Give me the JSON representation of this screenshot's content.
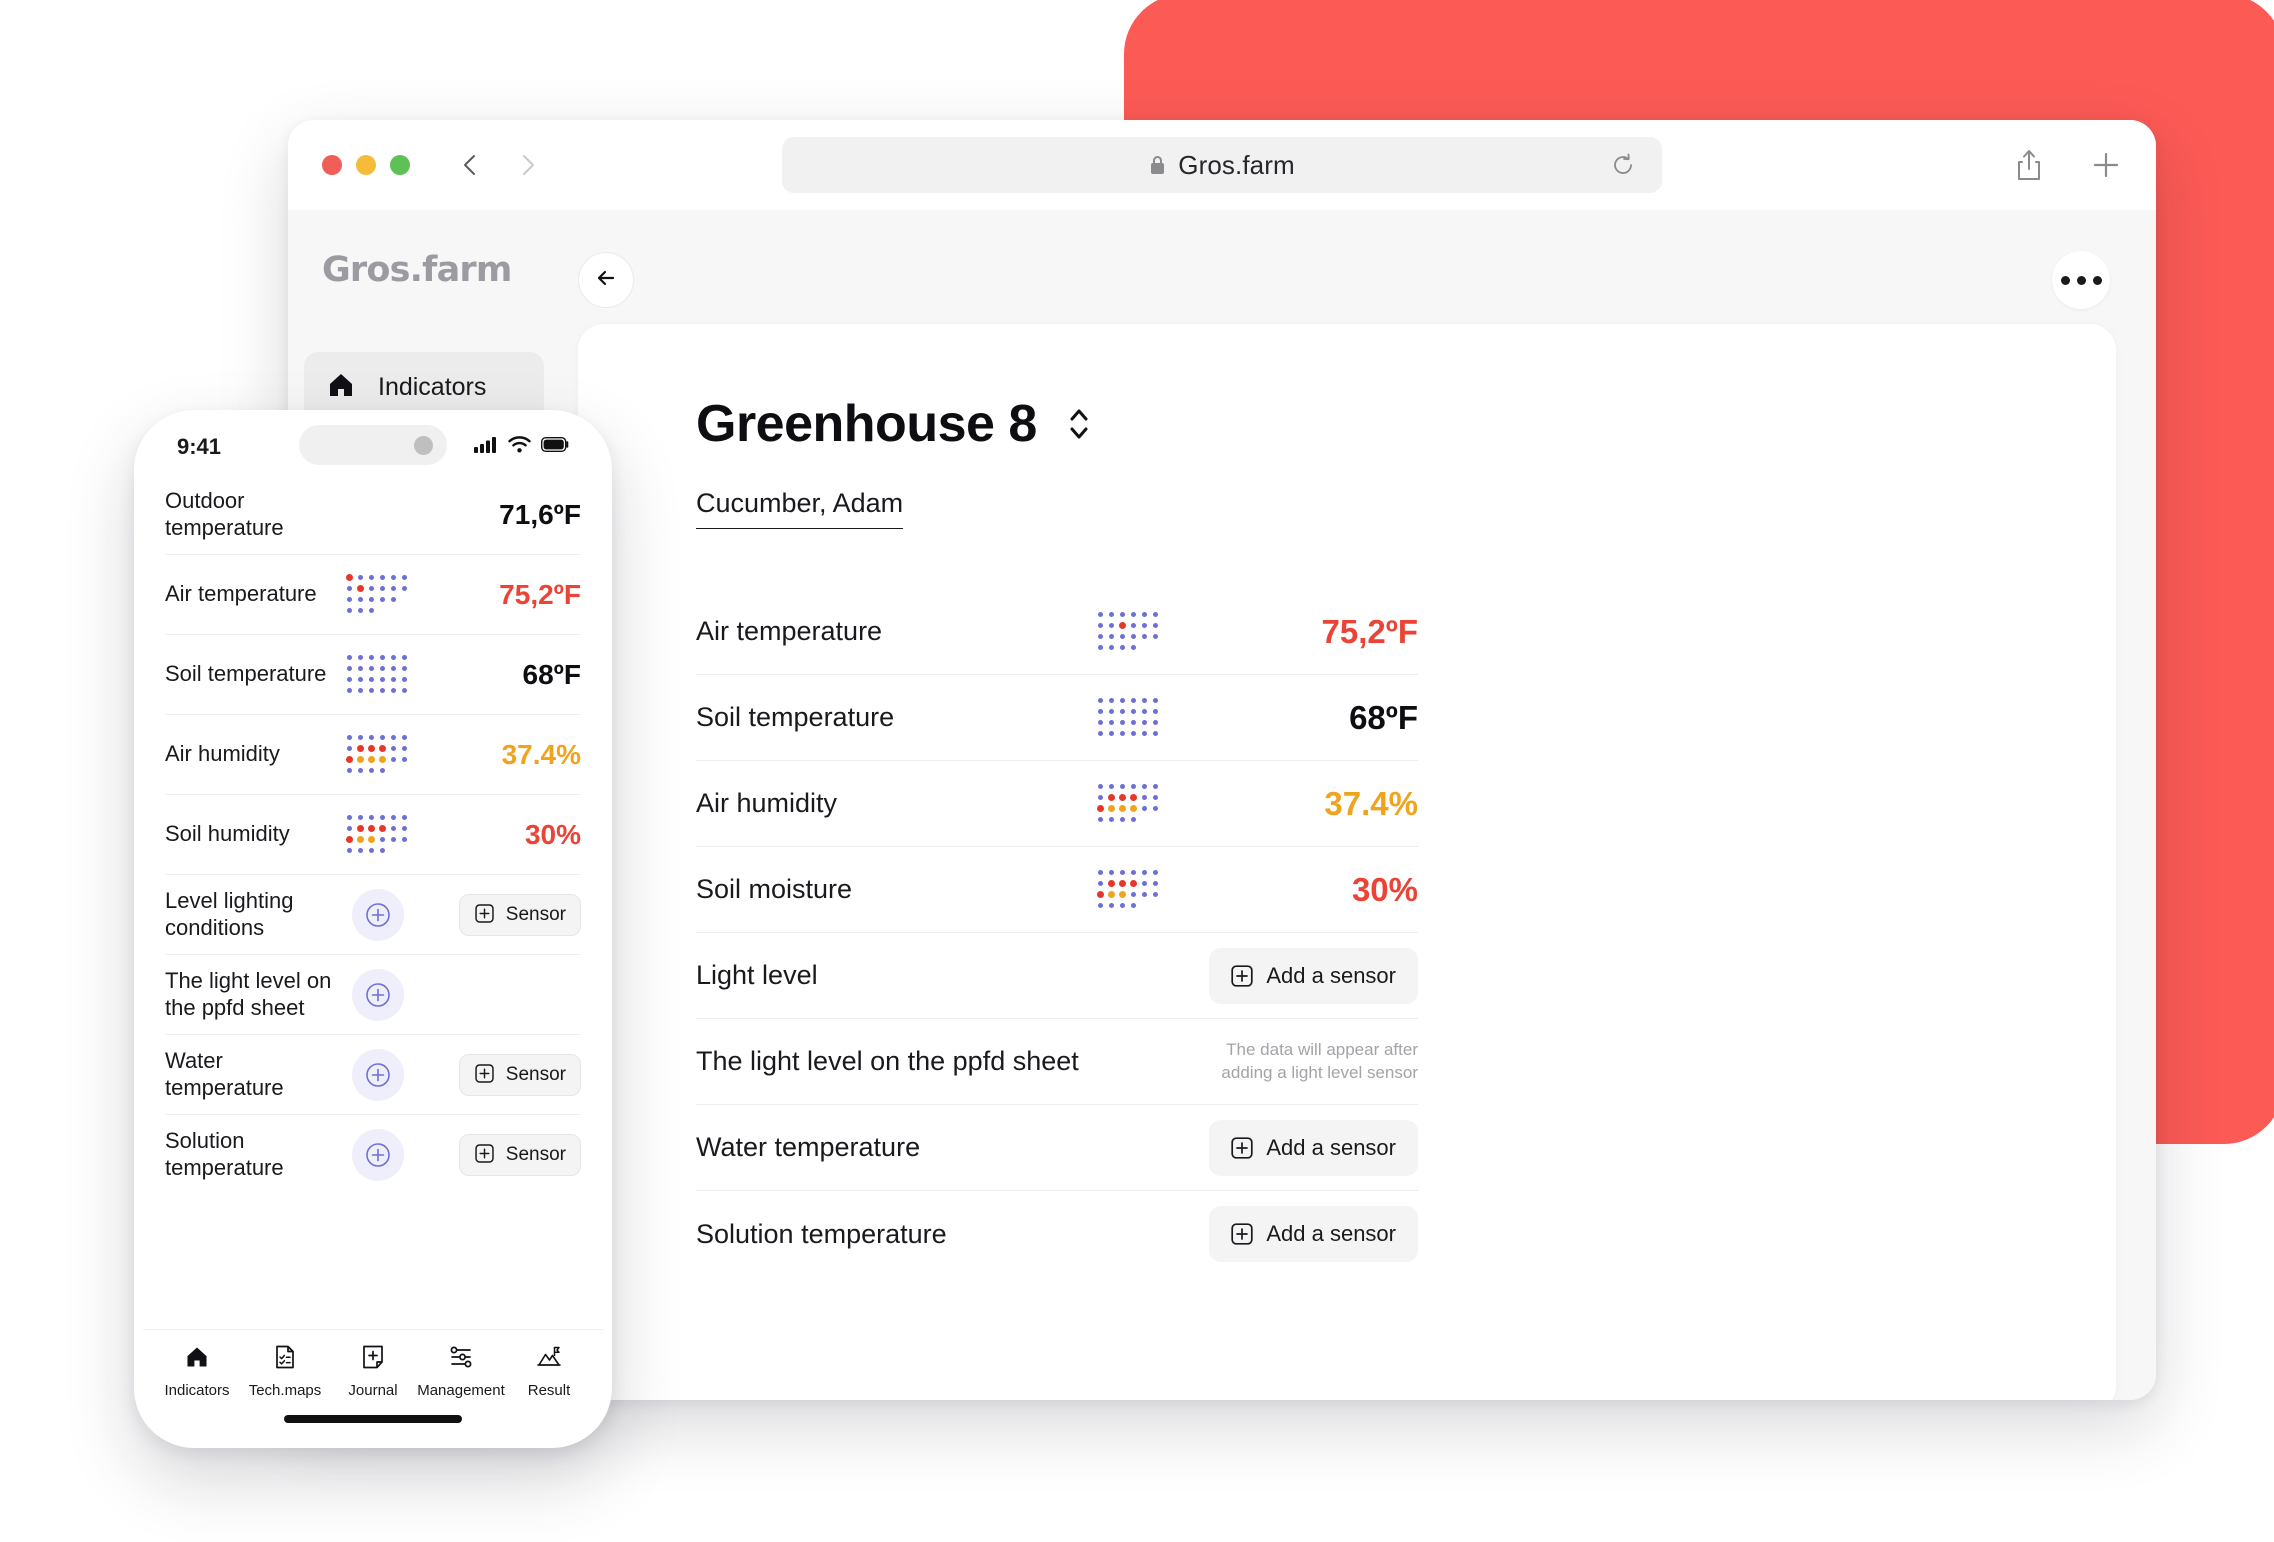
{
  "browser": {
    "url_text": "Gros.farm",
    "lock_icon": "lock-icon",
    "reload_icon": "reload-icon",
    "back_icon": "chevron-left-icon",
    "forward_icon": "chevron-right-icon",
    "share_icon": "share-icon",
    "newtab_icon": "plus-icon",
    "traffic_lights": [
      "close-red",
      "minimize-yellow",
      "zoom-green"
    ]
  },
  "app": {
    "brand": "Gros.farm",
    "back_button_icon": "arrow-left-icon",
    "more_button_icon": "ellipsis-icon",
    "sidebar": {
      "items": [
        {
          "label": "Indicators",
          "icon": "home-icon",
          "active": true
        }
      ]
    },
    "header": {
      "title": "Greenhouse 8",
      "selector_icon": "chevron-up-down-icon",
      "crop": "Cucumber, Adam"
    },
    "rows": [
      {
        "label": "Air temperature",
        "value": "75,2ºF",
        "color": "red",
        "indicator": "dot-matrix",
        "level": "high"
      },
      {
        "label": "Soil temperature",
        "value": "68ºF",
        "color": "dark",
        "indicator": "dot-matrix",
        "level": "normal"
      },
      {
        "label": "Air humidity",
        "value": "37.4%",
        "color": "orange",
        "indicator": "dot-matrix",
        "level": "low"
      },
      {
        "label": "Soil moisture",
        "value": "30%",
        "color": "red",
        "indicator": "dot-matrix",
        "level": "low"
      },
      {
        "label": "Light level",
        "action": "Add a sensor"
      },
      {
        "label": "The light level on the ppfd sheet",
        "hint": "The data will appear after adding a light level sensor"
      },
      {
        "label": "Water temperature",
        "action": "Add a sensor"
      },
      {
        "label": "Solution temperature",
        "action": "Add a sensor"
      }
    ],
    "add_sensor_label": "Add a sensor"
  },
  "phone": {
    "status": {
      "time": "9:41",
      "signal_icon": "cellular-icon",
      "wifi_icon": "wifi-icon",
      "battery_icon": "battery-icon"
    },
    "rows": [
      {
        "label": "Outdoor temperature",
        "value": "71,6ºF",
        "color": "dark",
        "indicator": "none"
      },
      {
        "label": "Air temperature",
        "value": "75,2ºF",
        "color": "red",
        "indicator": "dot-matrix",
        "level": "high"
      },
      {
        "label": "Soil temperature",
        "value": "68ºF",
        "color": "dark",
        "indicator": "dot-matrix",
        "level": "normal"
      },
      {
        "label": "Air humidity",
        "value": "37.4%",
        "color": "orange",
        "indicator": "dot-matrix",
        "level": "low"
      },
      {
        "label": "Soil humidity",
        "value": "30%",
        "color": "red",
        "indicator": "dot-matrix",
        "level": "low"
      },
      {
        "label": "Level lighting conditions",
        "add_circle": true,
        "action": "Sensor"
      },
      {
        "label": "The light level on the ppfd sheet",
        "add_circle": true
      },
      {
        "label": "Water temperature",
        "add_circle": true,
        "action": "Sensor"
      },
      {
        "label": "Solution temperature",
        "add_circle": true,
        "action": "Sensor"
      }
    ],
    "tabs": [
      {
        "label": "Indicators",
        "icon": "home-icon",
        "active": true
      },
      {
        "label": "Tech.maps",
        "icon": "document-check-icon",
        "active": false
      },
      {
        "label": "Journal",
        "icon": "document-plus-icon",
        "active": false
      },
      {
        "label": "Management",
        "icon": "sliders-icon",
        "active": false
      },
      {
        "label": "Result",
        "icon": "mountain-flag-icon",
        "active": false
      }
    ]
  },
  "colors": {
    "accent_red": "#FC5A55",
    "value_red": "#EB4335",
    "value_orange": "#F0A41E",
    "dot_blue": "#6E6FD6",
    "brand_gray": "#9B9BA1"
  }
}
